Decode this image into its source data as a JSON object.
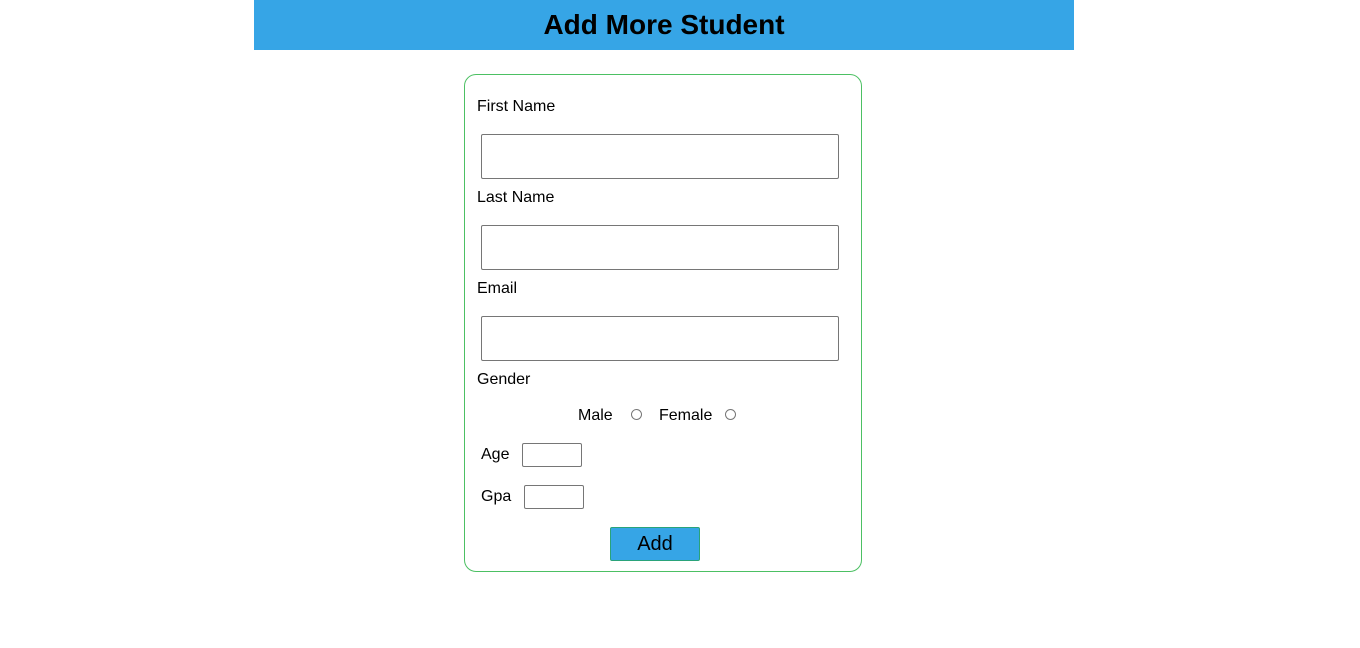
{
  "header": {
    "title": "Add More Student",
    "background": "#36a5e6"
  },
  "form": {
    "border_color": "#4cc063",
    "first_name": {
      "label": "First Name",
      "value": ""
    },
    "last_name": {
      "label": "Last Name",
      "value": ""
    },
    "email": {
      "label": "Email",
      "value": ""
    },
    "gender": {
      "label": "Gender",
      "options": [
        "Male",
        "Female"
      ],
      "selected": null
    },
    "age": {
      "label": "Age",
      "value": ""
    },
    "gpa": {
      "label": "Gpa",
      "value": ""
    },
    "submit_label": "Add"
  }
}
